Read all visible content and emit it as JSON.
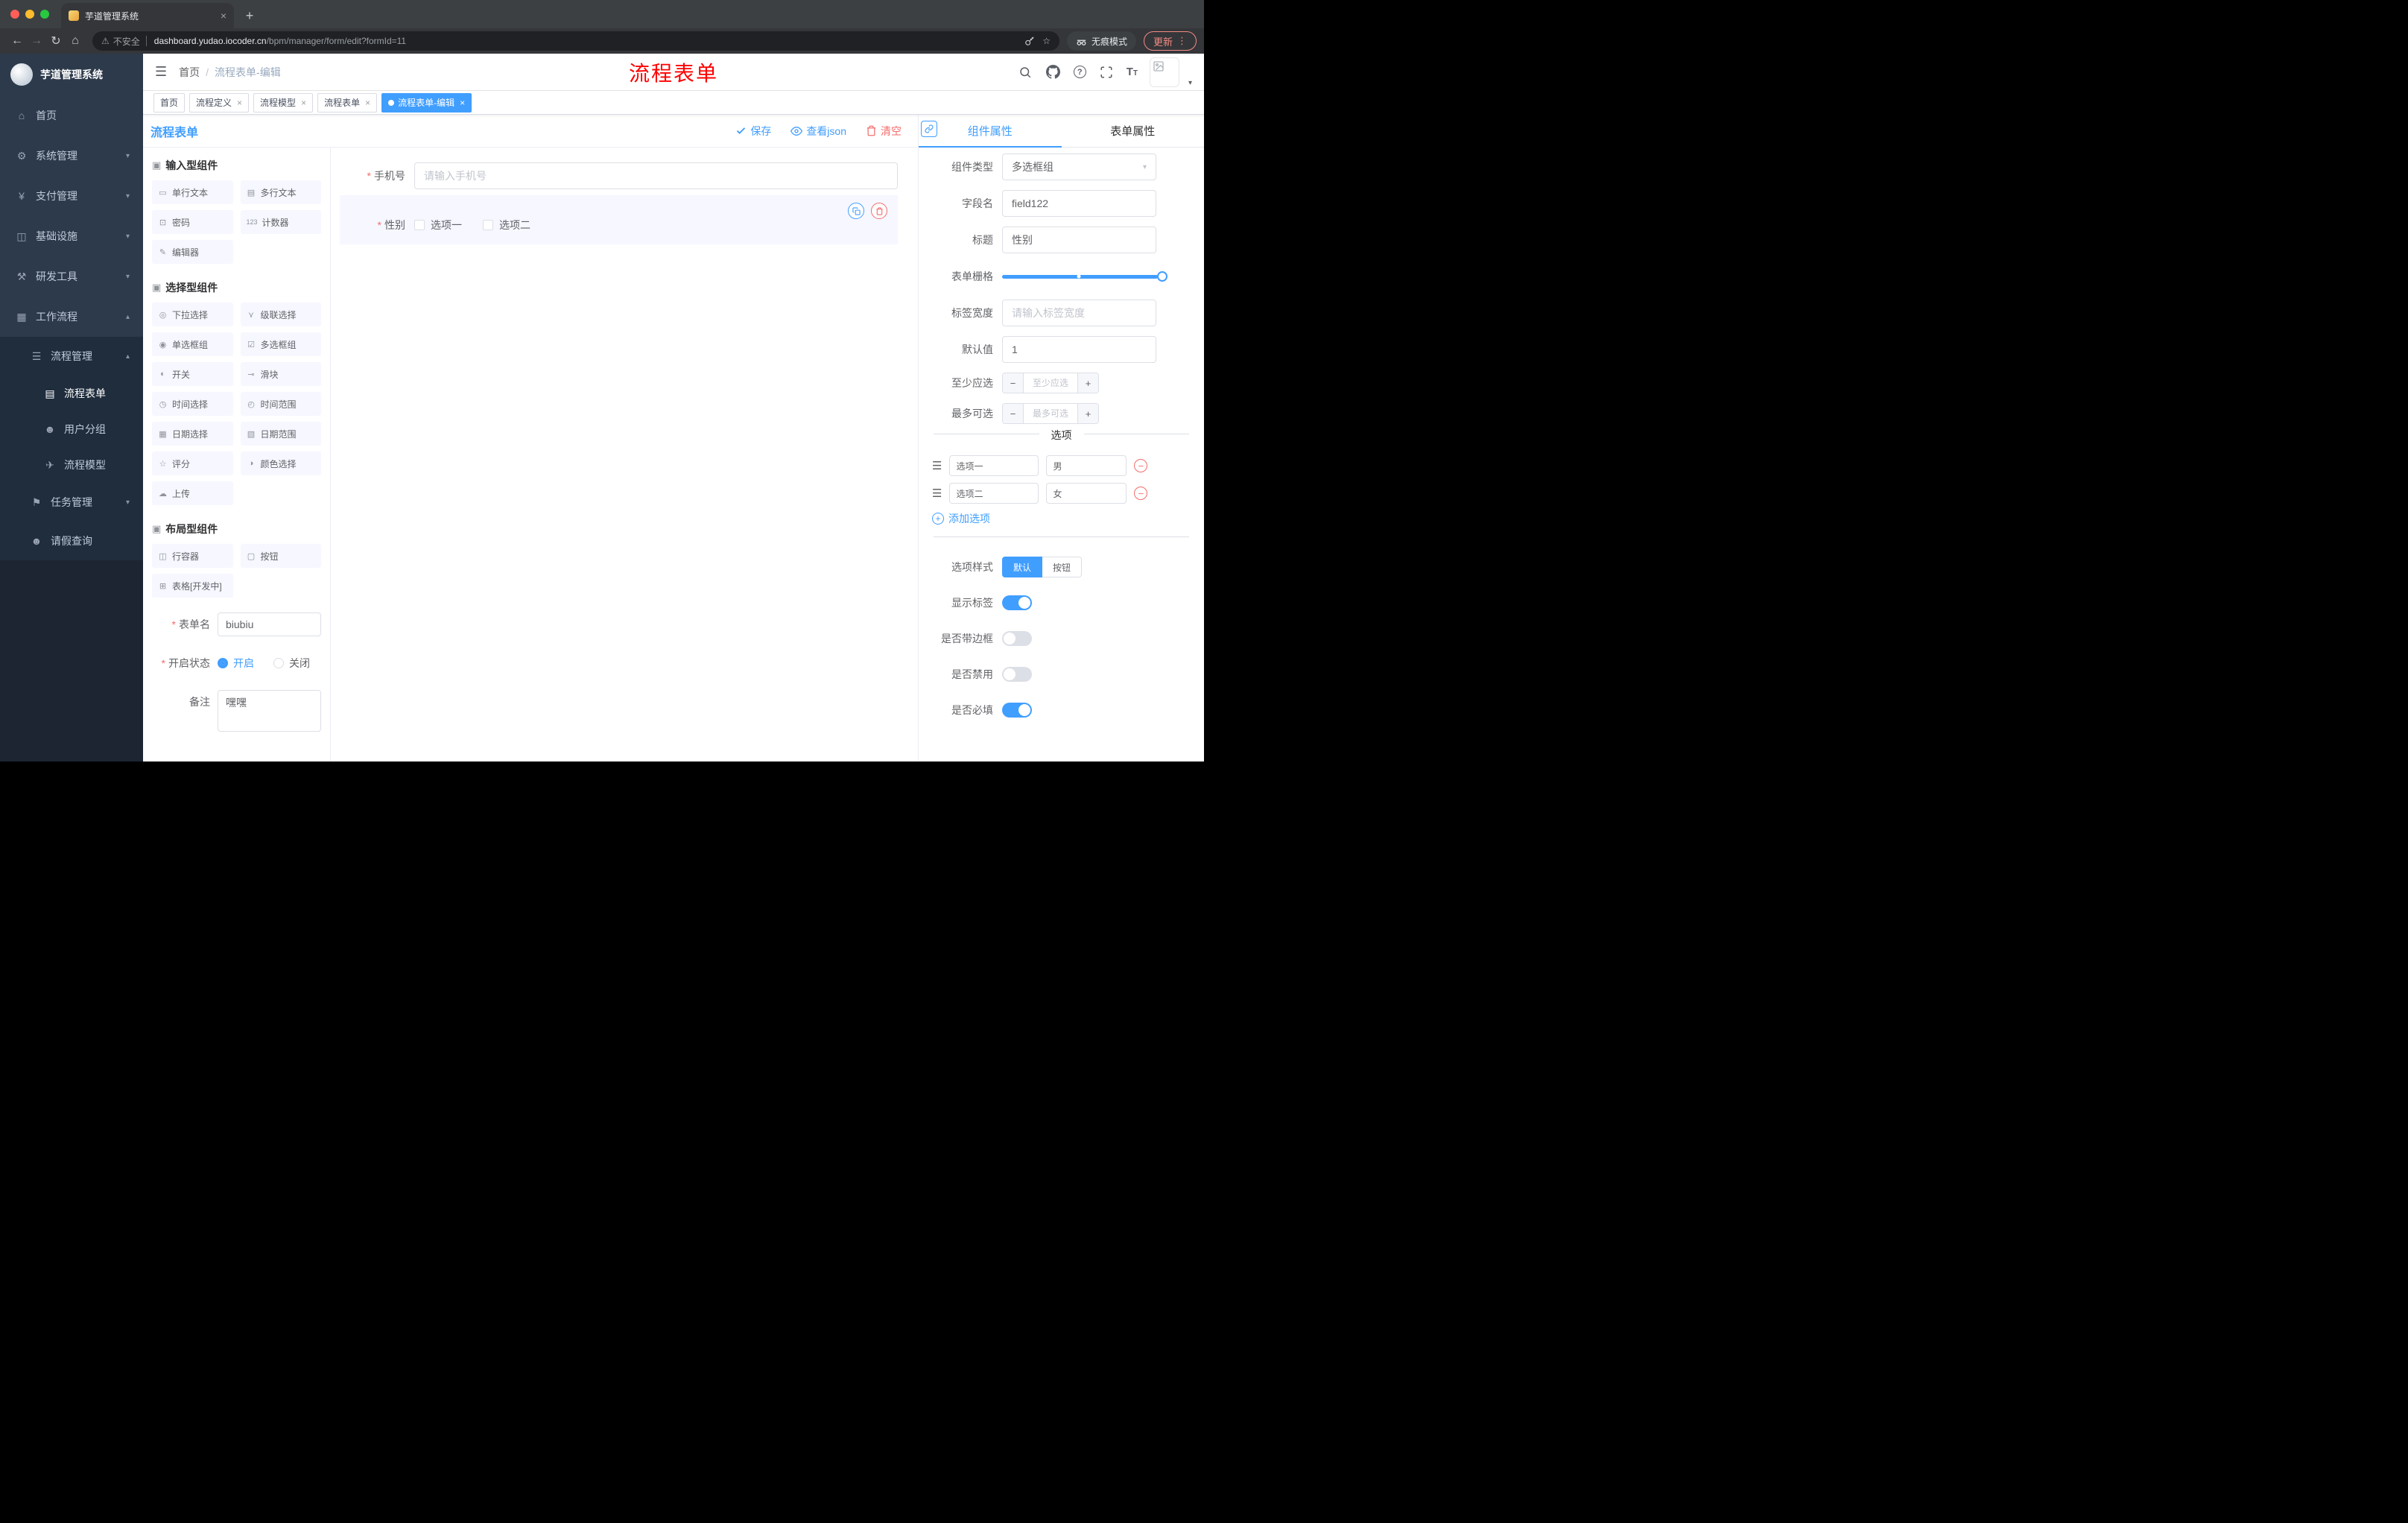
{
  "browser": {
    "tab_title": "芋道管理系统",
    "security": "不安全",
    "url_domain": "dashboard.yudao.iocoder.cn",
    "url_path": "/bpm/manager/form/edit?formId=11",
    "incognito": "无痕模式",
    "update": "更新"
  },
  "sidebar": {
    "logo": "芋道管理系统",
    "menu": [
      {
        "label": "首页",
        "icon": "⌂",
        "arrow": ""
      },
      {
        "label": "系统管理",
        "icon": "⚙",
        "arrow": "▾"
      },
      {
        "label": "支付管理",
        "icon": "¥",
        "arrow": "▾"
      },
      {
        "label": "基础设施",
        "icon": "◫",
        "arrow": "▾"
      },
      {
        "label": "研发工具",
        "icon": "⚒",
        "arrow": "▾"
      },
      {
        "label": "工作流程",
        "icon": "▦",
        "arrow": "▴"
      }
    ],
    "submenu": {
      "label": "流程管理",
      "icon": "☰",
      "arrow": "▴",
      "children": [
        {
          "label": "流程表单",
          "icon": "▤"
        },
        {
          "label": "用户分组",
          "icon": "☻"
        },
        {
          "label": "流程模型",
          "icon": "✈"
        }
      ]
    },
    "tail": [
      {
        "label": "任务管理",
        "icon": "⚑",
        "arrow": "▾"
      },
      {
        "label": "请假查询",
        "icon": "☻",
        "arrow": ""
      }
    ]
  },
  "header": {
    "breadcrumb": {
      "home": "首页",
      "sep": "/",
      "current": "流程表单-编辑"
    },
    "watermark": "流程表单"
  },
  "tabbar": [
    {
      "label": "首页"
    },
    {
      "label": "流程定义"
    },
    {
      "label": "流程模型"
    },
    {
      "label": "流程表单"
    },
    {
      "label": "流程表单-编辑"
    }
  ],
  "designer": {
    "title": "流程表单",
    "actions": {
      "save": "保存",
      "view_json": "查看json",
      "clear": "清空"
    },
    "palette": {
      "groups": [
        {
          "title": "输入型组件",
          "icon": "▣",
          "items": [
            {
              "label": "单行文本",
              "icon": "▭"
            },
            {
              "label": "多行文本",
              "icon": "▤"
            },
            {
              "label": "密码",
              "icon": "⊡"
            },
            {
              "label": "计数器",
              "icon": "123"
            },
            {
              "label": "编辑器",
              "icon": "✎"
            }
          ]
        },
        {
          "title": "选择型组件",
          "icon": "▣",
          "items": [
            {
              "label": "下拉选择",
              "icon": "◎"
            },
            {
              "label": "级联选择",
              "icon": "⋎"
            },
            {
              "label": "单选框组",
              "icon": "◉"
            },
            {
              "label": "多选框组",
              "icon": "☑"
            },
            {
              "label": "开关",
              "icon": "◐"
            },
            {
              "label": "滑块",
              "icon": "⊸"
            },
            {
              "label": "时间选择",
              "icon": "◷"
            },
            {
              "label": "时间范围",
              "icon": "◴"
            },
            {
              "label": "日期选择",
              "icon": "▦"
            },
            {
              "label": "日期范围",
              "icon": "▧"
            },
            {
              "label": "评分",
              "icon": "☆"
            },
            {
              "label": "颜色选择",
              "icon": "◑"
            },
            {
              "label": "上传",
              "icon": "☁"
            }
          ]
        },
        {
          "title": "布局型组件",
          "icon": "▣",
          "items": [
            {
              "label": "行容器",
              "icon": "◫"
            },
            {
              "label": "按钮",
              "icon": "▢"
            },
            {
              "label": "表格[开发中]",
              "icon": "⊞"
            }
          ]
        }
      ]
    },
    "meta": {
      "name_label": "表单名",
      "name_value": "biubiu",
      "status_label": "开启状态",
      "status_on": "开启",
      "status_off": "关闭",
      "remark_label": "备注",
      "remark_value": "嘿嘿"
    },
    "canvas": {
      "phone_label": "手机号",
      "phone_placeholder": "请输入手机号",
      "gender_label": "性别",
      "gender_options": [
        {
          "label": "选项一"
        },
        {
          "label": "选项二"
        }
      ]
    }
  },
  "props": {
    "tabs": {
      "component": "组件属性",
      "form": "表单属性"
    },
    "rows": {
      "type_label": "组件类型",
      "type_value": "多选框组",
      "field_label": "字段名",
      "field_value": "field122",
      "title_label": "标题",
      "title_value": "性别",
      "grid_label": "表单栅格",
      "width_label": "标签宽度",
      "width_placeholder": "请输入标签宽度",
      "default_label": "默认值",
      "default_value": "1",
      "min_label": "至少应选",
      "min_placeholder": "至少应选",
      "max_label": "最多可选",
      "max_placeholder": "最多可选"
    },
    "options": {
      "divider": "选项",
      "rows": [
        {
          "name": "选项一",
          "value": "男"
        },
        {
          "name": "选项二",
          "value": "女"
        }
      ],
      "add": "添加选项"
    },
    "style": {
      "label": "选项样式",
      "default": "默认",
      "button": "按钮"
    },
    "toggles": [
      {
        "label": "显示标签",
        "on": true
      },
      {
        "label": "是否带边框",
        "on": false
      },
      {
        "label": "是否禁用",
        "on": false
      },
      {
        "label": "是否必填",
        "on": true
      }
    ]
  }
}
